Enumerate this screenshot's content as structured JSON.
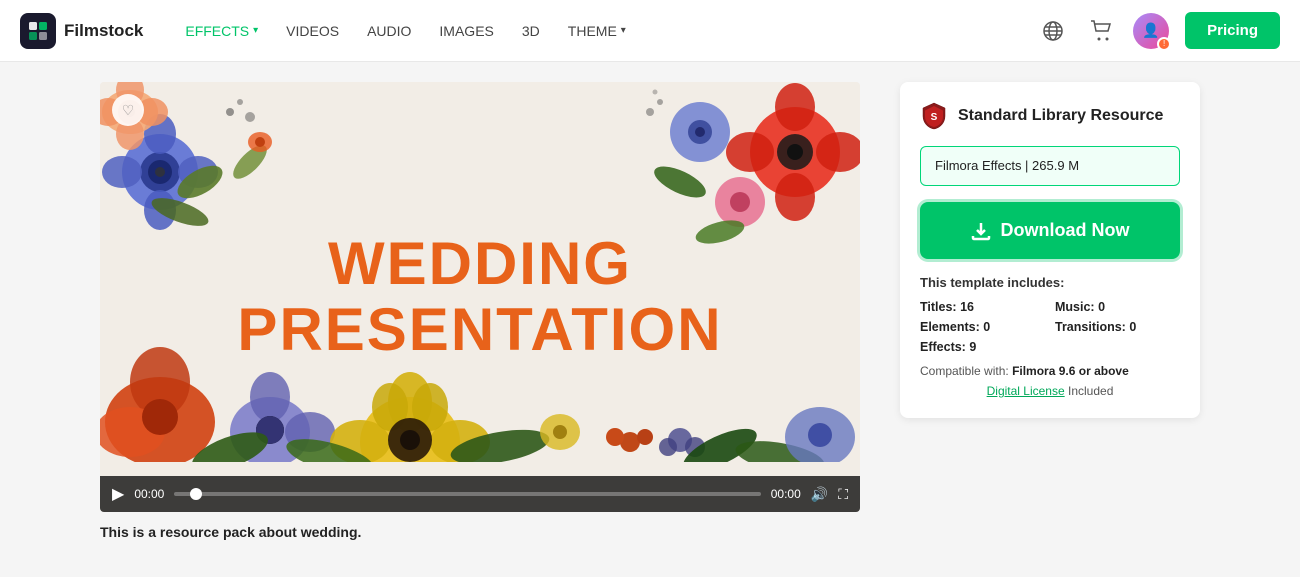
{
  "header": {
    "logo_text": "Filmstock",
    "nav": [
      {
        "label": "EFFECTS",
        "active": true,
        "has_chevron": true
      },
      {
        "label": "VIDEOS",
        "active": false,
        "has_chevron": false
      },
      {
        "label": "AUDIO",
        "active": false,
        "has_chevron": false
      },
      {
        "label": "IMAGES",
        "active": false,
        "has_chevron": false
      },
      {
        "label": "3D",
        "active": false,
        "has_chevron": false
      },
      {
        "label": "THEME",
        "active": false,
        "has_chevron": true
      }
    ],
    "pricing_label": "Pricing"
  },
  "video": {
    "title_line1": "WEDDING",
    "title_line2": "PRESENTATION",
    "play_time": "00:00",
    "end_time": "00:00",
    "heart_icon": "♡"
  },
  "sidebar": {
    "resource_title": "Standard Library Resource",
    "file_info": "Filmora Effects | 265.9 M",
    "download_label": "Download Now",
    "template_includes_label": "This template includes:",
    "titles_label": "Titles:",
    "titles_value": "16",
    "music_label": "Music:",
    "music_value": "0",
    "elements_label": "Elements:",
    "elements_value": "0",
    "transitions_label": "Transitions:",
    "transitions_value": "0",
    "effects_label": "Effects:",
    "effects_value": "9",
    "compatible_label": "Compatible with:",
    "compatible_value": "Filmora 9.6 or above",
    "license_link": "Digital License",
    "license_suffix": "Included"
  },
  "description": "This is a resource pack about wedding."
}
